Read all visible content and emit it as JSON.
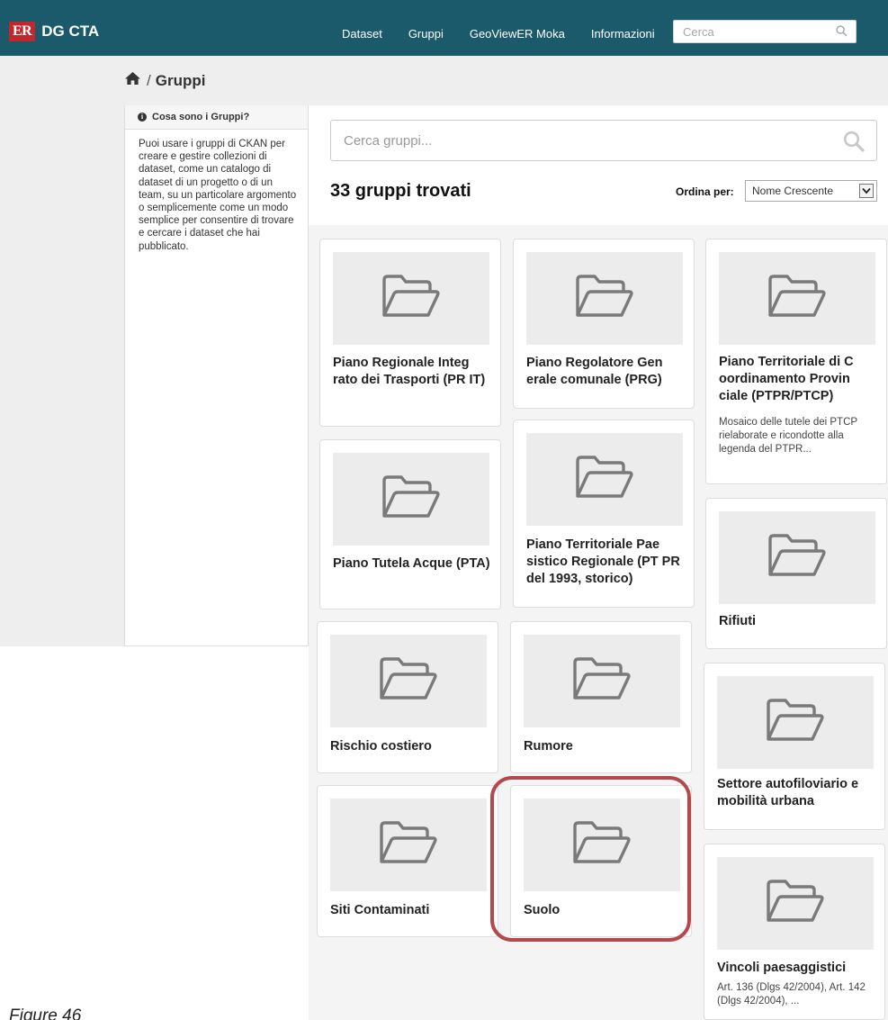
{
  "brand": {
    "er": "ER",
    "name": "DG CTA",
    "accent": "#c0282d",
    "bar_color": "#1b5a6a"
  },
  "nav": {
    "items": [
      "Dataset",
      "Gruppi",
      "GeoViewER Moka",
      "Informazioni"
    ],
    "search_placeholder": "Cerca"
  },
  "breadcrumb": {
    "home_icon": "home-icon",
    "separator": "/",
    "current": "Gruppi"
  },
  "sidebar": {
    "title": "Cosa sono i Gruppi?",
    "body": "Puoi usare i gruppi di CKAN per creare e gestire collezioni di dataset, come un catalogo di dataset di un progetto o di un team, su un particolare argomento o semplicemente come un modo semplice per consentire di trovare e cercare i dataset che hai pubblicato."
  },
  "main": {
    "search_placeholder": "Cerca gruppi...",
    "count_text": "33 gruppi trovati",
    "order_label": "Ordina per:",
    "order_value": "Nome Crescente"
  },
  "groups": [
    {
      "title": "Piano Regionale Integ rato dei Trasporti (PR IT)",
      "description": ""
    },
    {
      "title": "Piano Regolatore Gen erale comunale (PRG)",
      "description": ""
    },
    {
      "title": "Piano Territoriale di C oordinamento Provin ciale (PTPR/PTCP)",
      "description": "Mosaico delle tutele dei PTCP rielaborate e ricondotte alla legenda del PTPR..."
    },
    {
      "title": "Piano Tutela Acque (PTA)",
      "description": ""
    },
    {
      "title": "Piano Territoriale Pae sistico Regionale (PT PR del 1993, storico)",
      "description": ""
    },
    {
      "title": "Rifiuti",
      "description": ""
    },
    {
      "title": "Rischio costiero",
      "description": ""
    },
    {
      "title": "Rumore",
      "description": ""
    },
    {
      "title": "Settore autofiloviario e mobilità urbana",
      "description": ""
    },
    {
      "title": "Siti Contaminati",
      "description": ""
    },
    {
      "title": "Suolo",
      "description": ""
    },
    {
      "title": "Vincoli paesaggistici",
      "description": "Art. 136 (Dlgs 42/2004), Art. 142 (Dlgs 42/2004), ..."
    }
  ],
  "highlight_color": "#b5484b",
  "caption": "Figure 46"
}
